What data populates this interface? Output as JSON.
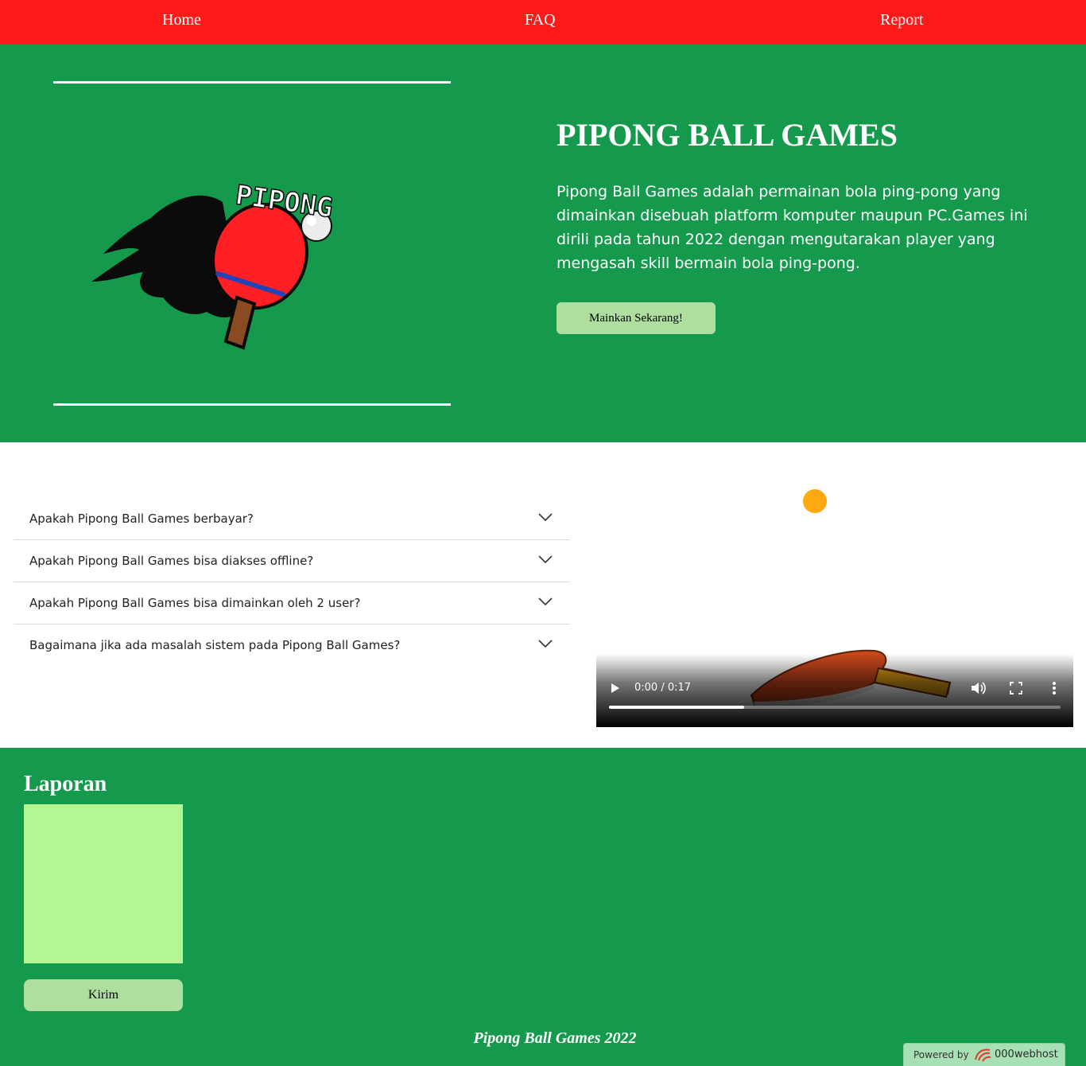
{
  "nav": {
    "items": [
      {
        "label": "Home"
      },
      {
        "label": "FAQ"
      },
      {
        "label": "Report"
      }
    ],
    "background": "#ff1a1a"
  },
  "hero": {
    "title": "PIPONG BALL GAMES",
    "description": "Pipong Ball Games adalah permainan bola ping-pong yang dimainkan disebuah platform komputer maupun PC.Games ini dirili pada tahun 2022 dengan mengutarakan player yang mengasah skill bermain bola ping-pong.",
    "cta_label": "Mainkan Sekarang!",
    "logo_text": "PIPONG",
    "background": "#159a4d"
  },
  "faq": {
    "items": [
      {
        "question": "Apakah Pipong Ball Games berbayar?"
      },
      {
        "question": "Apakah Pipong Ball Games bisa diakses offline?"
      },
      {
        "question": "Apakah Pipong Ball Games bisa dimainkan oleh 2 user?"
      },
      {
        "question": "Bagaimana jika ada masalah sistem pada Pipong Ball Games?"
      }
    ]
  },
  "video": {
    "time": "0:00 / 0:17",
    "progress": 0.3,
    "ball_color": "#ffa910"
  },
  "report": {
    "title": "Laporan",
    "textarea_value": "",
    "submit_label": "Kirim",
    "textarea_color": "#b2f793"
  },
  "footer": {
    "text": "Pipong Ball Games 2022",
    "powered_label": "Powered by",
    "powered_brand": "000webhost"
  }
}
